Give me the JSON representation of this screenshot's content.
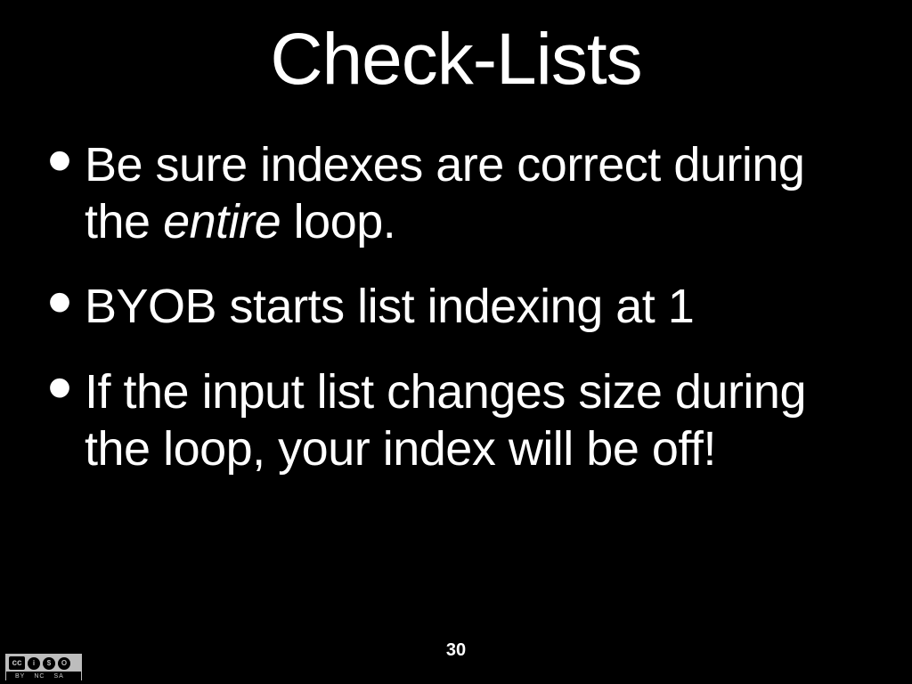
{
  "slide": {
    "title": "Check-Lists",
    "bullets": [
      {
        "pre": "Be sure indexes are correct during the ",
        "em": "entire",
        "post": " loop."
      },
      {
        "pre": "BYOB starts list indexing at 1",
        "em": "",
        "post": ""
      },
      {
        "pre": "If the input list changes size during the loop, your index will be off!",
        "em": "",
        "post": ""
      }
    ],
    "page_number": "30"
  },
  "license": {
    "logo": "cc",
    "icons": [
      "i",
      "$",
      "O"
    ],
    "labels": [
      "BY",
      "NC",
      "SA"
    ]
  }
}
